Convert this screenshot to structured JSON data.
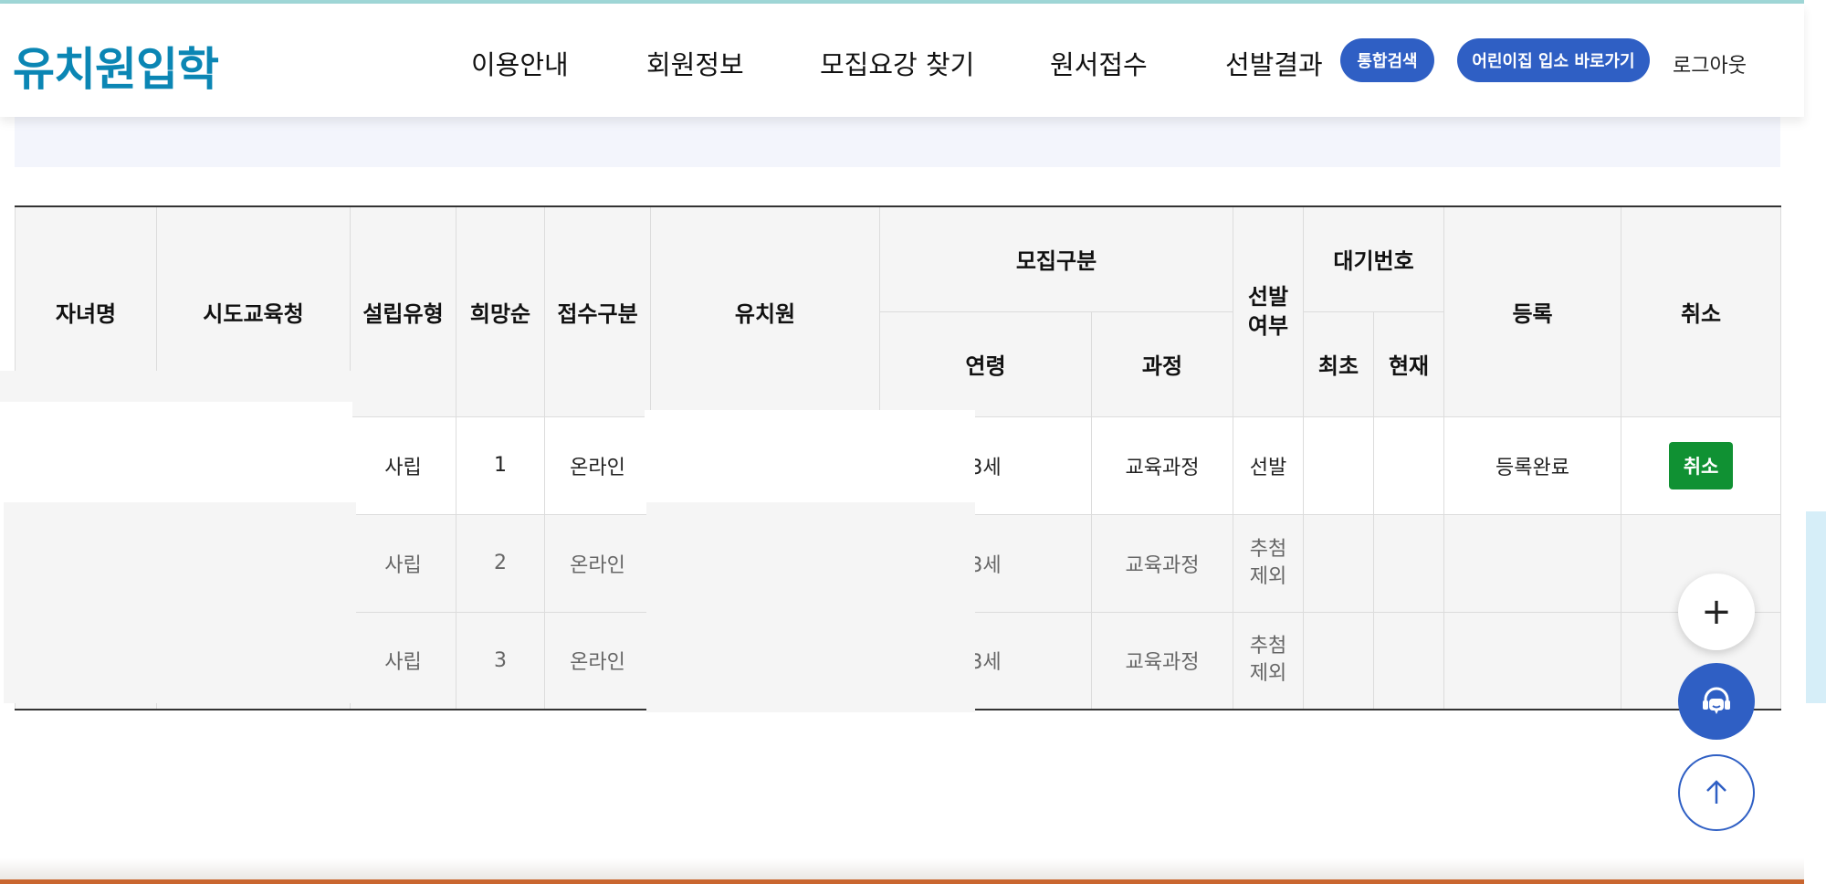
{
  "header": {
    "logo": "유치원입학",
    "nav": [
      "이용안내",
      "회원정보",
      "모집요강 찾기",
      "원서접수",
      "선발결과"
    ],
    "search_button": "통합검색",
    "daycare_button": "어린이집 입소 바로가기",
    "logout": "로그아웃"
  },
  "table": {
    "headers": {
      "child_name": "자녀명",
      "office": "시도교육청",
      "type": "설립유형",
      "priority": "희망순",
      "apply_type": "접수구분",
      "kindergarten": "유치원",
      "recruit": "모집구분",
      "age": "연령",
      "course": "과정",
      "selected": "선발\n여부",
      "waiting": "대기번호",
      "first": "최초",
      "current": "현재",
      "register": "등록",
      "cancel": "취소"
    },
    "rows": [
      {
        "type": "사립",
        "priority": "1",
        "apply_type": "온라인",
        "age": "3세",
        "course": "교육과정",
        "status": "선발",
        "register": "등록완료",
        "cancel": "취소"
      },
      {
        "type": "사립",
        "priority": "2",
        "apply_type": "온라인",
        "age": "3세",
        "course": "교육과정",
        "status": "추첨\n제외",
        "register": "",
        "cancel": ""
      },
      {
        "type": "사립",
        "priority": "3",
        "apply_type": "온라인",
        "age": "3세",
        "course": "교육과정",
        "status": "추첨\n제외",
        "register": "",
        "cancel": ""
      }
    ]
  },
  "floating": {
    "plus_icon": "plus-icon",
    "chat_icon": "headset-chat-icon",
    "top_icon": "arrow-up-icon"
  },
  "colors": {
    "brand": "#0b86b4",
    "accent_blue": "#2f5fc4",
    "cancel_green": "#109133"
  }
}
